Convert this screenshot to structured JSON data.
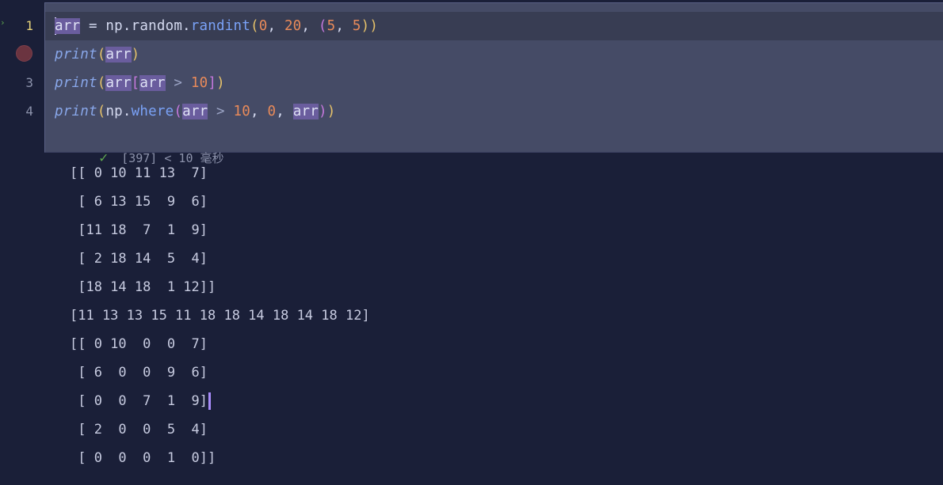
{
  "gutter": {
    "line_numbers": [
      "1",
      "",
      "3",
      "4"
    ]
  },
  "code": {
    "lines": [
      [
        {
          "t": "arr",
          "c": "hl"
        },
        {
          "t": " = np.random.",
          "c": "id"
        },
        {
          "t": "randint",
          "c": "kw"
        },
        {
          "t": "(",
          "c": "paren"
        },
        {
          "t": "0",
          "c": "num"
        },
        {
          "t": ", ",
          "c": "id"
        },
        {
          "t": "20",
          "c": "num"
        },
        {
          "t": ", ",
          "c": "id"
        },
        {
          "t": "(",
          "c": "paren2"
        },
        {
          "t": "5",
          "c": "num"
        },
        {
          "t": ", ",
          "c": "id"
        },
        {
          "t": "5",
          "c": "num"
        },
        {
          "t": "))",
          "c": "paren"
        }
      ],
      [
        {
          "t": "print",
          "c": "fn"
        },
        {
          "t": "(",
          "c": "paren"
        },
        {
          "t": "arr",
          "c": "hl"
        },
        {
          "t": ")",
          "c": "paren"
        }
      ],
      [
        {
          "t": "print",
          "c": "fn"
        },
        {
          "t": "(",
          "c": "paren"
        },
        {
          "t": "arr",
          "c": "hl"
        },
        {
          "t": "[",
          "c": "paren2"
        },
        {
          "t": "arr",
          "c": "hl"
        },
        {
          "t": " > ",
          "c": "op"
        },
        {
          "t": "10",
          "c": "num"
        },
        {
          "t": "]",
          "c": "paren2"
        },
        {
          "t": ")",
          "c": "paren"
        }
      ],
      [
        {
          "t": "print",
          "c": "fn"
        },
        {
          "t": "(",
          "c": "paren"
        },
        {
          "t": "np.",
          "c": "id"
        },
        {
          "t": "where",
          "c": "kw"
        },
        {
          "t": "(",
          "c": "paren2"
        },
        {
          "t": "arr",
          "c": "hl"
        },
        {
          "t": " > ",
          "c": "op"
        },
        {
          "t": "10",
          "c": "num"
        },
        {
          "t": ", ",
          "c": "id"
        },
        {
          "t": "0",
          "c": "num"
        },
        {
          "t": ", ",
          "c": "id"
        },
        {
          "t": "arr",
          "c": "hl"
        },
        {
          "t": ")",
          "c": "paren2"
        },
        {
          "t": ")",
          "c": "paren"
        }
      ]
    ]
  },
  "status": {
    "text": "[397] < 10 毫秒"
  },
  "output": {
    "lines": [
      "[[ 0 10 11 13  7]",
      " [ 6 13 15  9  6]",
      " [11 18  7  1  9]",
      " [ 2 18 14  5  4]",
      " [18 14 18  1 12]]",
      "[11 13 13 15 11 18 18 14 18 14 18 12]",
      "[[ 0 10  0  0  7]",
      " [ 6  0  0  9  6]",
      " [ 0  0  7  1  9]",
      " [ 2  0  0  5  4]",
      " [ 0  0  0  1  0]]"
    ]
  },
  "colors": {
    "background": "#1a1f38",
    "cell": "#454b66",
    "keyword": "#7aa2f7",
    "number": "#e88a5a",
    "success": "#5fa84f",
    "breakpoint": "#6b3440"
  }
}
